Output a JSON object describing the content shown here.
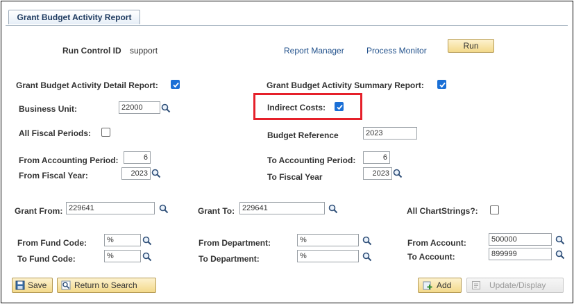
{
  "tab": {
    "label": "Grant Budget Activity Report"
  },
  "header": {
    "run_control_label": "Run Control ID",
    "run_control_value": "support",
    "report_manager": "Report Manager",
    "process_monitor": "Process Monitor",
    "run_button": "Run"
  },
  "options": {
    "detail_label": "Grant Budget Activity Detail Report:",
    "detail_checked": true,
    "summary_label": "Grant Budget Activity Summary Report:",
    "summary_checked": true,
    "business_unit_label": "Business Unit:",
    "business_unit_value": "22000",
    "indirect_costs_label": "Indirect Costs:",
    "indirect_costs_checked": true,
    "all_fiscal_label": "All Fiscal Periods:",
    "all_fiscal_checked": false,
    "budget_ref_label": "Budget Reference",
    "budget_ref_value": "2023",
    "from_acct_period_label": "From Accounting Period:",
    "from_acct_period_value": "6",
    "to_acct_period_label": "To Accounting Period:",
    "to_acct_period_value": "6",
    "from_fy_label": "From Fiscal Year:",
    "from_fy_value": "2023",
    "to_fy_label": "To Fiscal Year",
    "to_fy_value": "2023"
  },
  "grant": {
    "from_label": "Grant From:",
    "from_value": "229641",
    "to_label": "Grant To:",
    "to_value": "229641",
    "all_chartstrings_label": "All ChartStrings?:",
    "all_chartstrings_checked": false
  },
  "chartfields": {
    "from_fund_label": "From Fund Code:",
    "from_fund_value": "%",
    "to_fund_label": "To Fund Code:",
    "to_fund_value": "%",
    "from_dept_label": "From Department:",
    "from_dept_value": "%",
    "to_dept_label": "To Department:",
    "to_dept_value": "%",
    "from_account_label": "From Account:",
    "from_account_value": "500000",
    "to_account_label": "To Account:",
    "to_account_value": "899999"
  },
  "footer": {
    "save": "Save",
    "return_to_search": "Return to Search",
    "add": "Add",
    "update_display": "Update/Display"
  },
  "colors": {
    "highlight": "#e5202a",
    "checkbox": "#1a6fd6",
    "link": "#1f4f8a",
    "button": "#f3d98a"
  }
}
